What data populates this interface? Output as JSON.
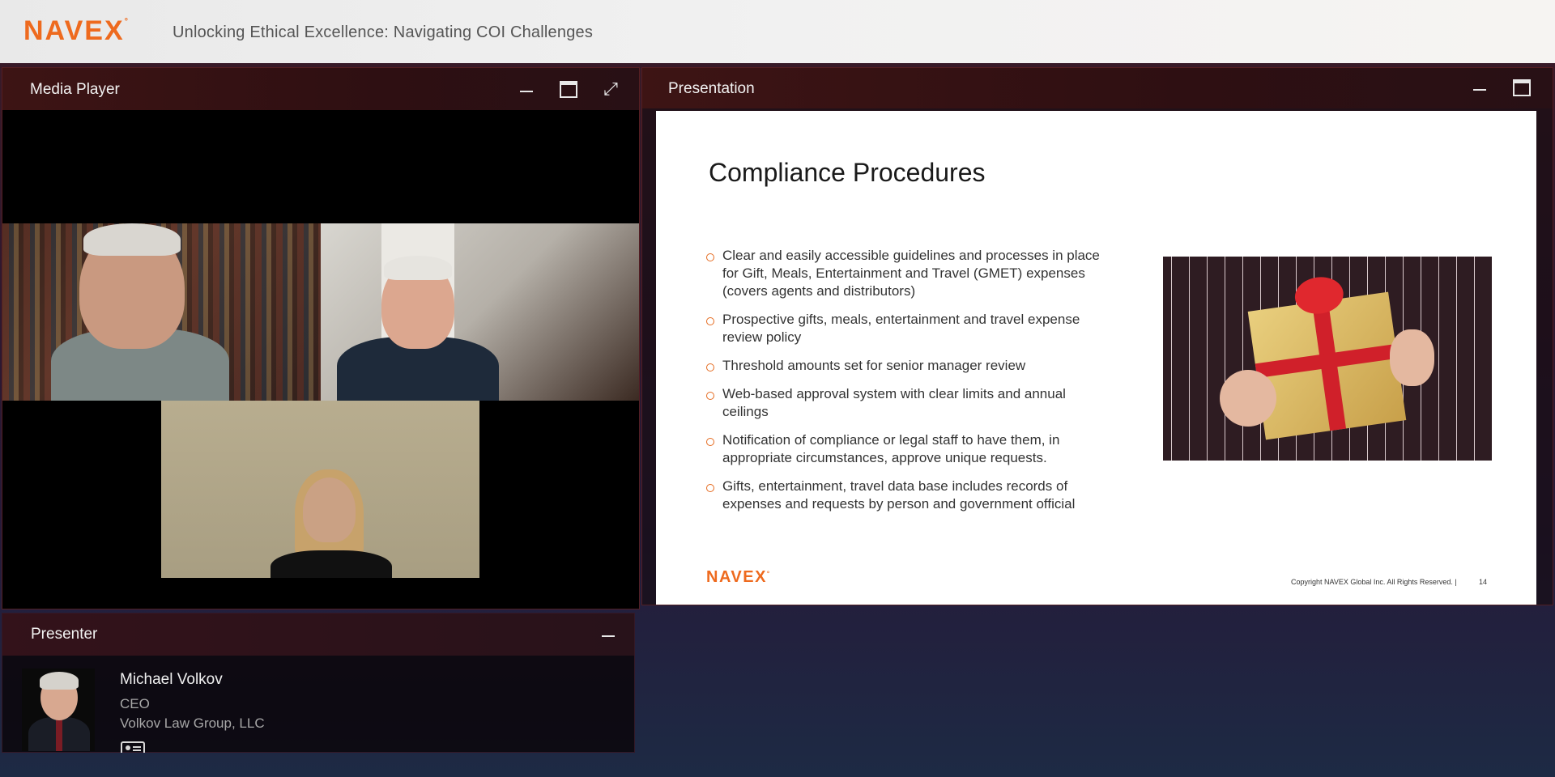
{
  "header": {
    "logo_text": "NAVEX",
    "event_title": "Unlocking Ethical Excellence: Navigating COI Challenges"
  },
  "media_player": {
    "title": "Media Player",
    "controls": [
      "minimize-icon",
      "maximize-icon",
      "expand-icon"
    ]
  },
  "presentation": {
    "title": "Presentation",
    "controls": [
      "minimize-icon",
      "maximize-icon"
    ],
    "slide": {
      "title": "Compliance Procedures",
      "bullets": [
        "Clear and easily accessible guidelines and processes in place for Gift, Meals, Entertainment and Travel (GMET) expenses (covers agents and distributors)",
        "Prospective gifts, meals, entertainment and travel expense review policy",
        "Threshold amounts set for senior manager review",
        "Web-based approval system with clear limits and annual ceilings",
        "Notification of compliance or legal staff to have them, in appropriate circumstances, approve unique requests.",
        "Gifts, entertainment, travel data base includes records of expenses and requests by person and government official"
      ],
      "logo_text": "NAVEX",
      "copyright": "Copyright NAVEX Global Inc. All Rights Reserved.   |",
      "page_number": "14"
    }
  },
  "presenter": {
    "title": "Presenter",
    "name": "Michael Volkov",
    "role": "CEO",
    "organization": "Volkov Law Group, LLC"
  },
  "colors": {
    "brand_orange": "#ee6a1e",
    "panel_header": "#3d1414"
  }
}
